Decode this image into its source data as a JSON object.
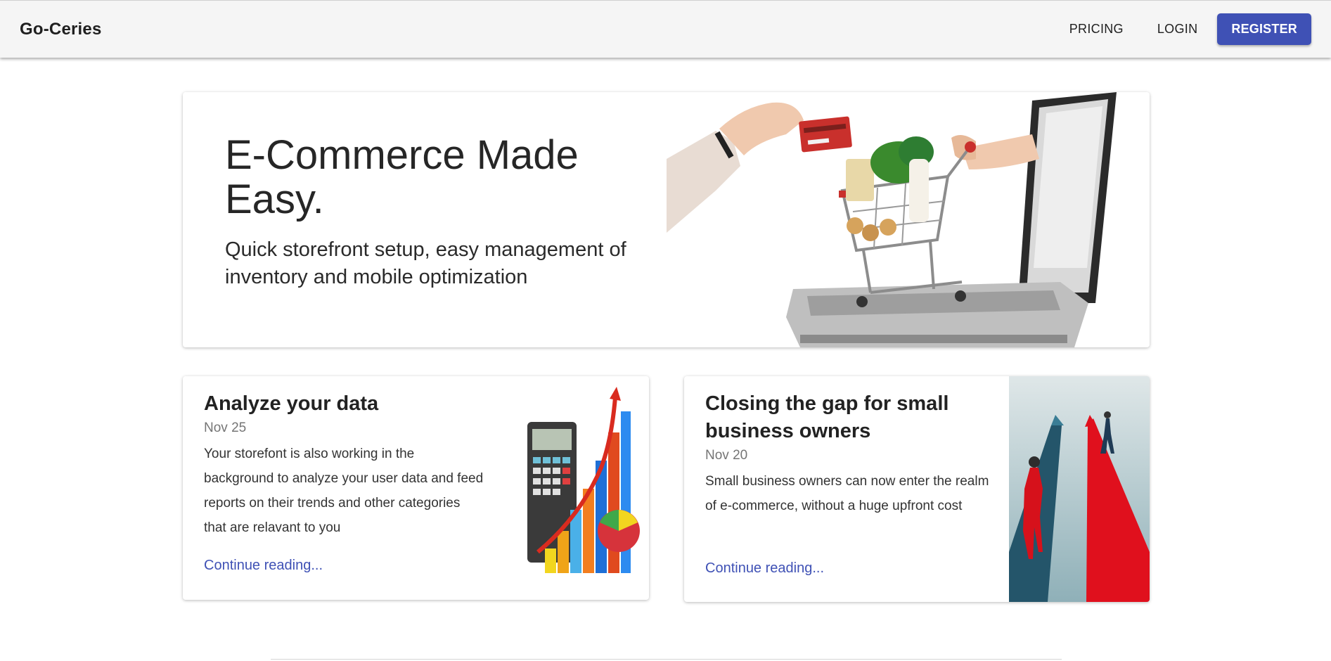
{
  "header": {
    "brand": "Go-Ceries",
    "nav": {
      "pricing": "PRICING",
      "login": "LOGIN",
      "register": "REGISTER"
    }
  },
  "hero": {
    "title": "E-Commerce Made Easy.",
    "subtitle": "Quick storefront setup, easy management of inventory and mobile optimization"
  },
  "cards": [
    {
      "title": "Analyze your data",
      "date": "Nov 25",
      "text": "Your storefont is also working in the background to analyze your user data and feed reports on their trends and other categories that are relavant to you",
      "link": "Continue reading..."
    },
    {
      "title": "Closing the gap for small business owners",
      "date": "Nov 20",
      "text": "Small business owners can now enter the realm of e-commerce, without a huge upfront cost",
      "link": "Continue reading..."
    }
  ],
  "colors": {
    "primary": "#3f51b5",
    "appbar": "#f5f5f5"
  }
}
